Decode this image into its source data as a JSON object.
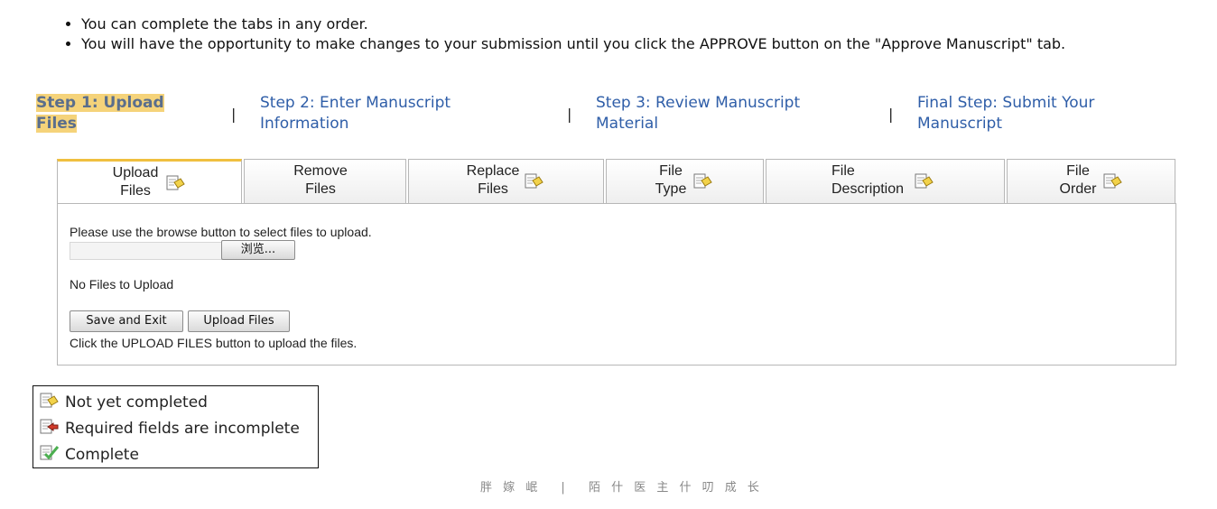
{
  "bullets": [
    "You can complete the tabs in any order.",
    "You will have the opportunity to make changes to your submission until you click the APPROVE button on the \"Approve Manuscript\" tab."
  ],
  "steps": [
    {
      "line1": "Step 1: Upload",
      "line2": "Files"
    },
    {
      "line1": "Step 2: Enter Manuscript",
      "line2": "Information"
    },
    {
      "line1": "Step 3: Review Manuscript",
      "line2": "Material"
    },
    {
      "line1": "Final Step: Submit Your",
      "line2": "Manuscript"
    }
  ],
  "step_separator": "|",
  "tabs": [
    {
      "line1": "Upload",
      "line2": "Files",
      "status_icon": "not-yet-completed-icon",
      "active": true
    },
    {
      "line1": "Remove",
      "line2": "Files",
      "status_icon": "",
      "active": false
    },
    {
      "line1": "Replace",
      "line2": "Files",
      "status_icon": "not-yet-completed-icon",
      "active": false
    },
    {
      "line1": "File",
      "line2": "Type",
      "status_icon": "not-yet-completed-icon",
      "active": false
    },
    {
      "line1": "File",
      "line2": "Description",
      "status_icon": "not-yet-completed-icon",
      "active": false
    },
    {
      "line1": "File",
      "line2": "Order",
      "status_icon": "not-yet-completed-icon",
      "active": false
    }
  ],
  "upload": {
    "instruction": "Please use the browse button to select files to upload.",
    "file_value": "",
    "browse_label": "浏览...",
    "no_files": "No Files to Upload",
    "save_exit_label": "Save and Exit",
    "upload_label": "Upload Files",
    "hint": "Click the UPLOAD FILES button to upload the files."
  },
  "legend": [
    {
      "icon": "not-yet-completed-icon",
      "label": "Not yet completed"
    },
    {
      "icon": "required-incomplete-icon",
      "label": "Required fields are incomplete"
    },
    {
      "icon": "complete-icon",
      "label": "Complete"
    }
  ],
  "footer": {
    "left": "胖 嫁 岷",
    "sep": "|",
    "right": "陌 什 医 主 什 叨 成 长"
  },
  "colors": {
    "active_step_highlight": "#f5d37a",
    "step_link": "#2f5ea8",
    "active_tab_top": "#f0c040",
    "pending_icon": "#f2d24a",
    "error_icon": "#d23a2a",
    "complete_icon": "#4caf50"
  }
}
